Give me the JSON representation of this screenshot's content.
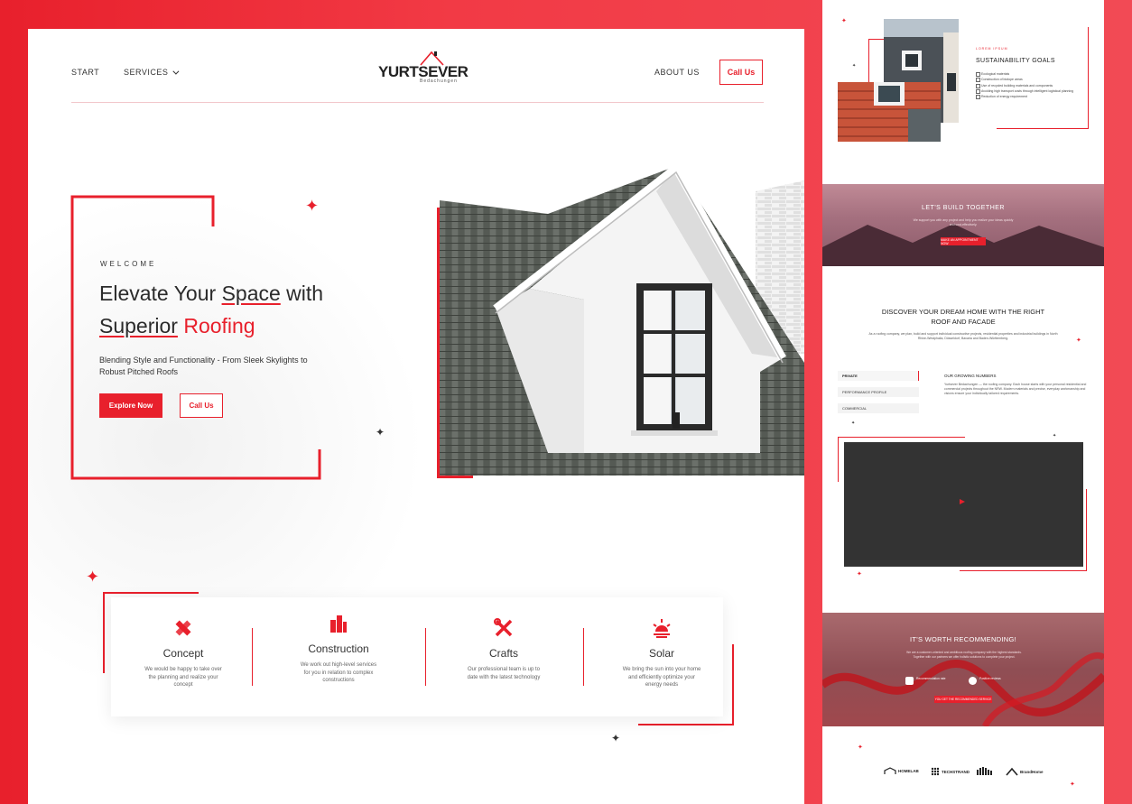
{
  "nav": {
    "start": "START",
    "services": "SERVICES",
    "about": "ABOUT US",
    "call": "Call Us"
  },
  "logo": {
    "name": "YURTSEVER",
    "sub": "Bedachungen"
  },
  "hero": {
    "welcome": "WELCOME",
    "headline_1a": "Elevate Your ",
    "headline_1b": "Space",
    "headline_1c": " with",
    "headline_2a": "Superior",
    "headline_2b": " Roofing",
    "subtitle": "Blending Style and Functionality - From Sleek Skylights to Robust Pitched Roofs",
    "explore": "Explore Now",
    "call": "Call Us"
  },
  "services": [
    {
      "title": "Concept",
      "desc": "We would be happy to take over the planning and realize your concept",
      "icon": "ruler-pencil-icon"
    },
    {
      "title": "Construction",
      "desc": "We work out high-level services for you in relation to complex constructions",
      "icon": "building-icon"
    },
    {
      "title": "Crafts",
      "desc": "Our professional team is up to date with the latest technology",
      "icon": "tools-icon"
    },
    {
      "title": "Solar",
      "desc": "We bring the sun into your home and efficiently optimize your energy needs",
      "icon": "sun-icon"
    }
  ],
  "right": {
    "small_label": "LOREM IPSUM",
    "sustainability_title": "SUSTAINABILITY GOALS",
    "sustainability_items": [
      "Ecological materials",
      "Construction of biotope areas",
      "Use of recycled building materials and components",
      "Avoiding high transport costs through intelligent logistical planning",
      "Reduction of energy requirement"
    ],
    "build_title": "LET'S BUILD TOGETHER",
    "build_text": "We support you with any project and help you realize your ideas quickly and cost-effectively.",
    "build_btn": "MAKE AN APPOINTMENT NOW",
    "discover_title": "DISCOVER YOUR DREAM HOME WITH THE RIGHT ROOF AND FACADE",
    "discover_text": "As a roofing company, we plan, build and support individual constructive projects, residential properties and industrial buildings in North Rhine-Westphalia, Düsseldorf, Bavaria and Baden-Württemberg.",
    "tabs": [
      "PRIVATE",
      "PERFORMANCE PROFILE",
      "COMMERCIAL"
    ],
    "tab_title": "OUR GROWING NUMBERS",
    "tab_text": "Yurtsever Bedachungen — the roofing company. Each house starts with your personal residential and commercial projects throughout the NRW. Modern materials and precise, everyday workmanship and visions ensure your individually tailored requirements.",
    "recommend_title": "IT'S WORTH RECOMMENDING!",
    "recommend_text": "We are a customer-oriented and ambitious roofing company with the highest standards. Together with our partners we offer holistic solutions to complete your project.",
    "badge1": "Recommendation rate",
    "badge2": "Positive reviews",
    "recommend_btn": "YOU GET THE RECOMMENDED SERVICE",
    "partners": [
      "HOMELAB",
      "TECHSTRAND",
      "",
      "BrandHome"
    ]
  }
}
